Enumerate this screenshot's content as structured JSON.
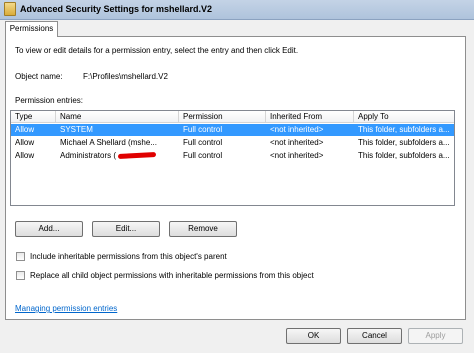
{
  "window": {
    "title": "Advanced Security Settings for mshellard.V2"
  },
  "tabs": [
    {
      "label": "Permissions"
    }
  ],
  "main": {
    "instructions": "To view or edit details for a permission entry, select the entry and then click Edit.",
    "object_name_label": "Object name:",
    "object_name_value": "F:\\Profiles\\mshellard.V2",
    "entries_label": "Permission entries:"
  },
  "table": {
    "columns": [
      "Type",
      "Name",
      "Permission",
      "Inherited From",
      "Apply To"
    ],
    "rows": [
      {
        "type": "Allow",
        "name": "SYSTEM",
        "permission": "Full control",
        "inherited": "<not inherited>",
        "apply": "This folder, subfolders a...",
        "selected": true
      },
      {
        "type": "Allow",
        "name": "Michael A Shellard (mshe...",
        "permission": "Full control",
        "inherited": "<not inherited>",
        "apply": "This folder, subfolders a...",
        "selected": false
      },
      {
        "type": "Allow",
        "name": "Administrators (",
        "permission": "Full control",
        "inherited": "<not inherited>",
        "apply": "This folder, subfolders a...",
        "selected": false
      }
    ]
  },
  "actions": {
    "add": "Add...",
    "edit": "Edit...",
    "remove": "Remove"
  },
  "options": {
    "include_inheritable": "Include inheritable permissions from this object's parent",
    "replace_child": "Replace all child object permissions with inheritable permissions from this object"
  },
  "link": "Managing permission entries",
  "footer": {
    "ok": "OK",
    "cancel": "Cancel",
    "apply": "Apply"
  },
  "colors": {
    "selection": "#3399ff",
    "link": "#0066cc",
    "redaction": "#e00000"
  }
}
